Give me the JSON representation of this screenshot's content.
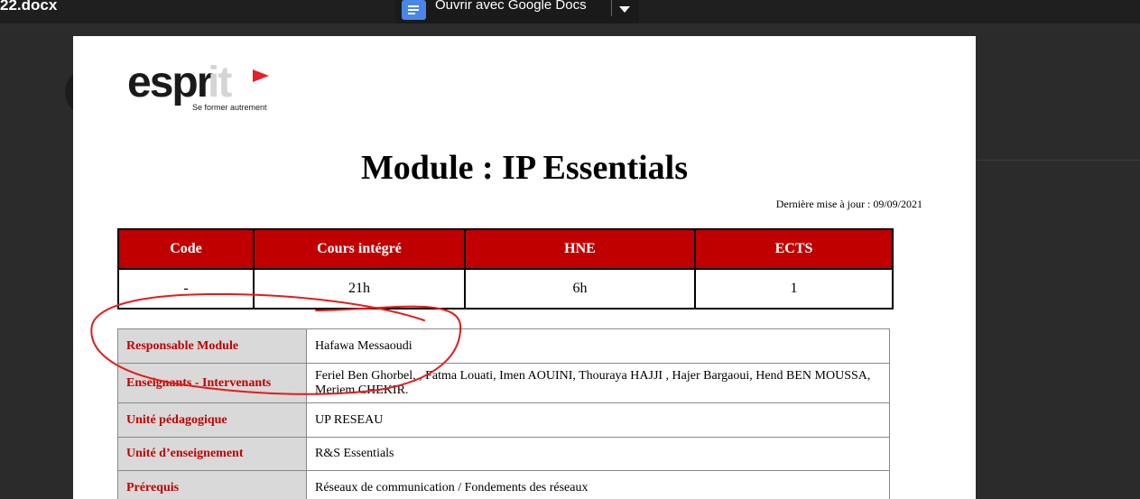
{
  "viewer": {
    "filename": "22.docx",
    "open_label": "Ouvrir avec Google Docs",
    "dropdown_icon": "chevron-down-icon"
  },
  "logo": {
    "brand_main": "espr",
    "brand_accent": "it",
    "tagline": "Se former autrement",
    "accent_color": "#e4202b"
  },
  "title": "Module : IP Essentials",
  "updated": "Dernière mise à jour : 09/09/2021",
  "summary": {
    "headers": [
      "Code",
      "Cours intégré",
      "HNE",
      "ECTS"
    ],
    "values": [
      "-",
      "21h",
      "6h",
      "1"
    ],
    "header_color": "#c00000"
  },
  "details": [
    {
      "label": "Responsable Module",
      "value": "Hafawa Messaoudi"
    },
    {
      "label": "Enseignants - Intervenants",
      "value": "Feriel Ben Ghorbel, , Fatma Louati, Imen AOUINI, Thouraya HAJJI , Hajer Bargaoui, Hend BEN MOUSSA, Meriem CHEKIR."
    },
    {
      "label": "Unité pédagogique",
      "value": "UP RESEAU"
    },
    {
      "label": "Unité d’enseignement",
      "value": "R&S Essentials"
    },
    {
      "label": "Prérequis",
      "value": "Réseaux de communication / Fondements des réseaux"
    }
  ]
}
